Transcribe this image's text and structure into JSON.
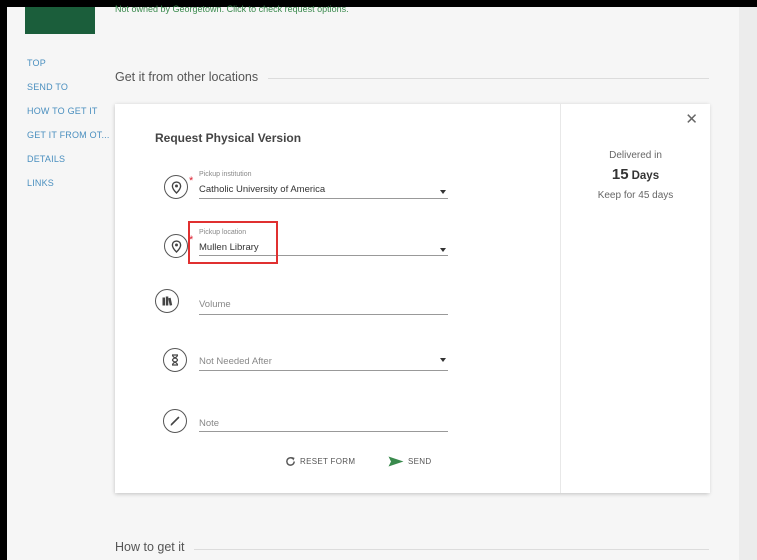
{
  "banner": {
    "not_owned_text": "Not owned by Georgetown. Click to check request options."
  },
  "side_nav": {
    "items": [
      {
        "label": "TOP"
      },
      {
        "label": "SEND TO"
      },
      {
        "label": "HOW TO GET IT"
      },
      {
        "label": "GET IT FROM OT..."
      },
      {
        "label": "DETAILS"
      },
      {
        "label": "LINKS"
      }
    ]
  },
  "sections": {
    "other_locations_title": "Get it from other locations",
    "how_to_get_it_title": "How to get it"
  },
  "request_form": {
    "title": "Request Physical Version",
    "pickup_institution": {
      "label": "Pickup institution",
      "value": "Catholic University of America"
    },
    "pickup_location": {
      "label": "Pickup location",
      "value": "Mullen Library"
    },
    "volume": {
      "placeholder": "Volume"
    },
    "not_needed_after": {
      "placeholder": "Not Needed After"
    },
    "note": {
      "placeholder": "Note"
    },
    "reset_label": "RESET FORM",
    "send_label": "SEND"
  },
  "delivery": {
    "delivered_in": "Delivered in",
    "days_number": "15",
    "days_unit": "Days",
    "keep_for": "Keep for 45 days"
  },
  "icons": {
    "close": "close-icon",
    "location": "map-pin-icon",
    "volume": "book-icon",
    "date": "hourglass-icon",
    "note": "pencil-icon",
    "reset": "refresh-icon",
    "send": "send-icon"
  },
  "colors": {
    "accent_green": "#3a8a4d",
    "nav_blue": "#4a8fbf",
    "required_red": "#dd2233",
    "highlight_red": "#e03030",
    "logo_green": "#1b5e3b"
  }
}
